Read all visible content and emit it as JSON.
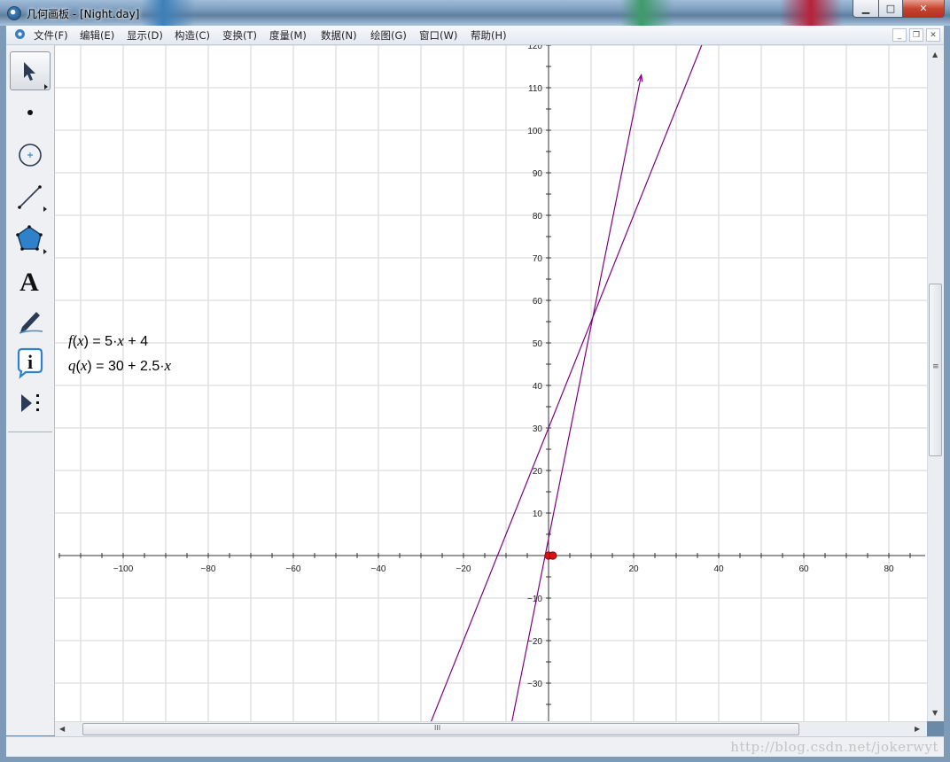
{
  "window": {
    "title": "几何画板 - [Night.day]",
    "minimize_glyph": "▁",
    "maximize_glyph": "□",
    "close_glyph": "✕"
  },
  "menu": {
    "items": [
      "文件(F)",
      "编辑(E)",
      "显示(D)",
      "构造(C)",
      "变换(T)",
      "度量(M)",
      "数据(N)",
      "绘图(G)",
      "窗口(W)",
      "帮助(H)"
    ],
    "mdi_minimize": "_",
    "mdi_restore": "❐",
    "mdi_close": "✕"
  },
  "toolbox": {
    "tools": [
      {
        "name": "arrow-select-tool",
        "icon": "arrow-cursor-icon",
        "selected": true
      },
      {
        "name": "point-tool",
        "icon": "point-icon"
      },
      {
        "name": "compass-tool",
        "icon": "circle-icon"
      },
      {
        "name": "straightedge-tool",
        "icon": "segment-icon"
      },
      {
        "name": "polygon-tool",
        "icon": "pentagon-icon"
      },
      {
        "name": "text-tool",
        "icon": "letter-a-icon",
        "glyph": "A"
      },
      {
        "name": "marker-tool",
        "icon": "pen-icon"
      },
      {
        "name": "information-tool",
        "icon": "info-icon",
        "glyph": "i"
      },
      {
        "name": "custom-tools",
        "icon": "play-more-icon"
      }
    ]
  },
  "functions": [
    {
      "fname": "f",
      "var": "x",
      "rhs_a": "5·",
      "rhs_var": "x",
      "rhs_b": " + 4"
    },
    {
      "fname": "q",
      "var": "x",
      "rhs_a": "30 + 2.5·",
      "rhs_var": "x",
      "rhs_b": ""
    }
  ],
  "scrollbar": {
    "grip": "≡",
    "hgrip": "III"
  },
  "watermark": "http://blog.csdn.net/jokerwyt",
  "chart_data": {
    "type": "line",
    "title": "",
    "xlabel": "",
    "ylabel": "",
    "x_ticks": [
      -100,
      -80,
      -60,
      -40,
      -20,
      20,
      40,
      60,
      80
    ],
    "y_ticks": [
      -30,
      -20,
      -10,
      10,
      20,
      30,
      40,
      50,
      60,
      70,
      80,
      90,
      100,
      110,
      120
    ],
    "xlim": [
      -115,
      89
    ],
    "ylim": [
      -39,
      120
    ],
    "grid": true,
    "series": [
      {
        "expr": "f(x) = 5x + 4",
        "slope": 5,
        "intercept": 4,
        "x_range": [
          -8.6,
          21.8
        ],
        "arrow_end": true,
        "color": "#800080"
      },
      {
        "expr": "q(x) = 30 + 2.5x",
        "slope": 2.5,
        "intercept": 30,
        "x_range": [
          -27.6,
          40
        ],
        "arrow_end": false,
        "color": "#800080"
      }
    ],
    "points": [
      {
        "x": 0,
        "y": 0,
        "color": "#dd1111"
      },
      {
        "x": 1,
        "y": 0,
        "color": "#dd1111"
      }
    ]
  }
}
